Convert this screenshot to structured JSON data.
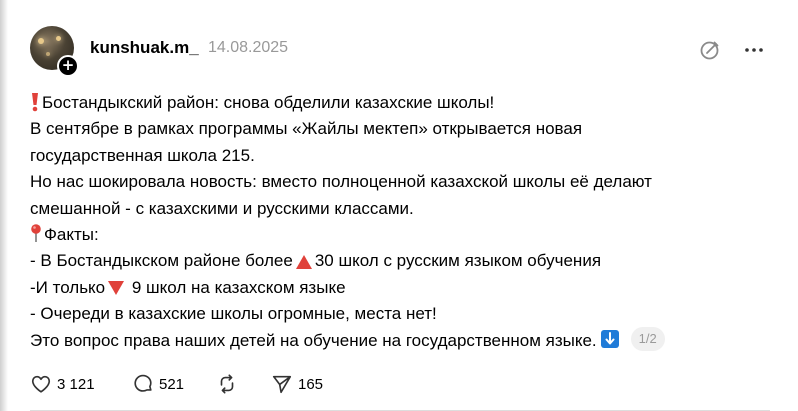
{
  "post": {
    "author": {
      "username": "kunshuak.m_",
      "avatar_badge": "+"
    },
    "date": "14.08.2025",
    "header_icons": [
      "edit-icon",
      "more-icon"
    ],
    "lines": {
      "l1": "Бостандыкский район: снова обделили казахские школы!",
      "l2": "В сентябре в рамках программы «Жайлы мектеп» открывается новая",
      "l3": "государственная школа 215.",
      "l4": "Но нас шокировала новость: вместо полноценной казахской школы её делают",
      "l5": "смешанной - с казахскими и русскими классами.",
      "l6": "Факты:",
      "l7": "- В Бостандыкском районе более",
      "l7b": "30 школ с русским языком обучения",
      "l8": "-И только",
      "l8b": " 9 школ на казахском языке",
      "l9": "- Очереди в казахские школы огромные, места нет!",
      "l10": "Это вопрос права наших детей на обучение на государственном языке."
    },
    "emoji_icons": [
      "exclamation-emoji",
      "round-pushpin-emoji",
      "up-triangle-emoji",
      "down-triangle-emoji",
      "down-arrow-emoji"
    ],
    "pager": "1/2",
    "actions": {
      "likes": "3 121",
      "comments": "521",
      "shares": "165"
    },
    "colors": {
      "text": "#000000",
      "muted": "#999999",
      "emoji_red": "#e0413a",
      "arrow_blue": "#1f7bd8"
    }
  }
}
